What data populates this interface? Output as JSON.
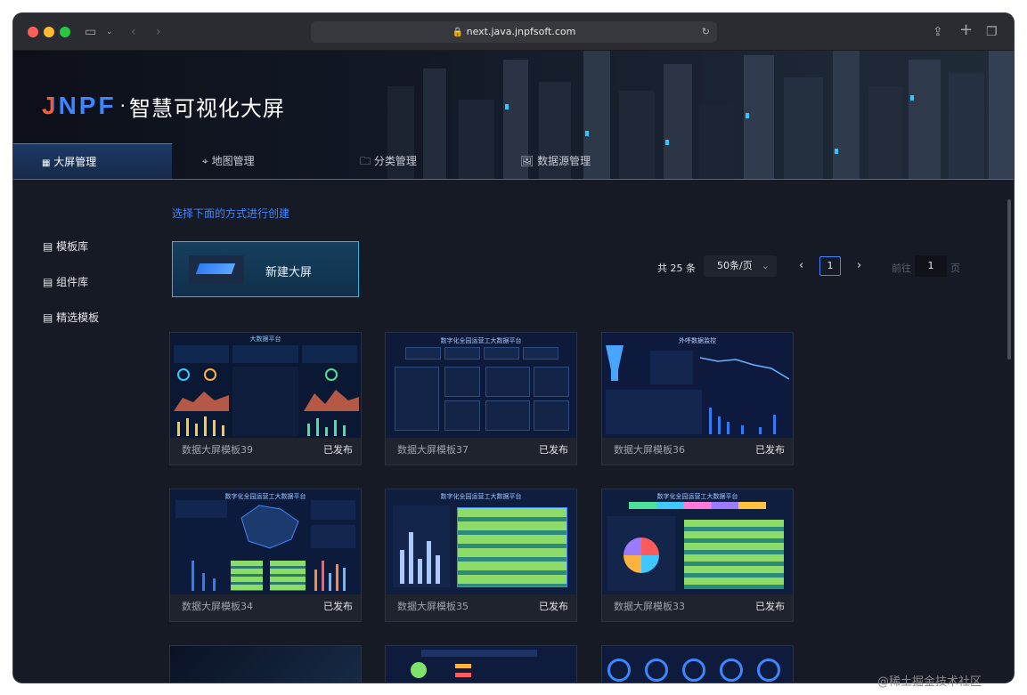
{
  "browser": {
    "url": "next.java.jnpfsoft.com"
  },
  "brand": {
    "logo_text": "JNPF",
    "separator": "·",
    "title": "智慧可视化大屏"
  },
  "tabs": [
    {
      "label": "大屏管理",
      "icon": "grid-icon"
    },
    {
      "label": "地图管理",
      "icon": "map-pin-icon"
    },
    {
      "label": "分类管理",
      "icon": "folder-icon"
    },
    {
      "label": "数据源管理",
      "icon": "image-icon"
    }
  ],
  "sidebar": {
    "items": [
      {
        "label": "模板库"
      },
      {
        "label": "组件库"
      },
      {
        "label": "精选模板"
      }
    ]
  },
  "main": {
    "create_hint": "选择下面的方式进行创建",
    "new_screen_label": "新建大屏"
  },
  "pagination": {
    "total_text": "共 25 条",
    "page_size": "50条/页",
    "current_page": "1",
    "goto_prefix": "前往",
    "goto_value": "1",
    "goto_suffix": "页"
  },
  "cards": [
    {
      "name": "数据大屏模板39",
      "status": "已发布",
      "header": "大数据平台"
    },
    {
      "name": "数据大屏模板37",
      "status": "已发布",
      "header": "数字化全园运营工大数据平台"
    },
    {
      "name": "数据大屏模板36",
      "status": "已发布",
      "header": "外呼数据监控"
    },
    {
      "name": "数据大屏模板34",
      "status": "已发布",
      "header": "数字化全园运营工大数据平台"
    },
    {
      "name": "数据大屏模板35",
      "status": "已发布",
      "header": "数字化全园运营工大数据平台"
    },
    {
      "name": "数据大屏模板33",
      "status": "已发布",
      "header": "数字化全园运营工大数据平台"
    }
  ],
  "watermark": "@稀土掘金技术社区",
  "colors": {
    "accent": "#2f7cf6",
    "bg": "#161a24",
    "card": "#1f232d"
  }
}
